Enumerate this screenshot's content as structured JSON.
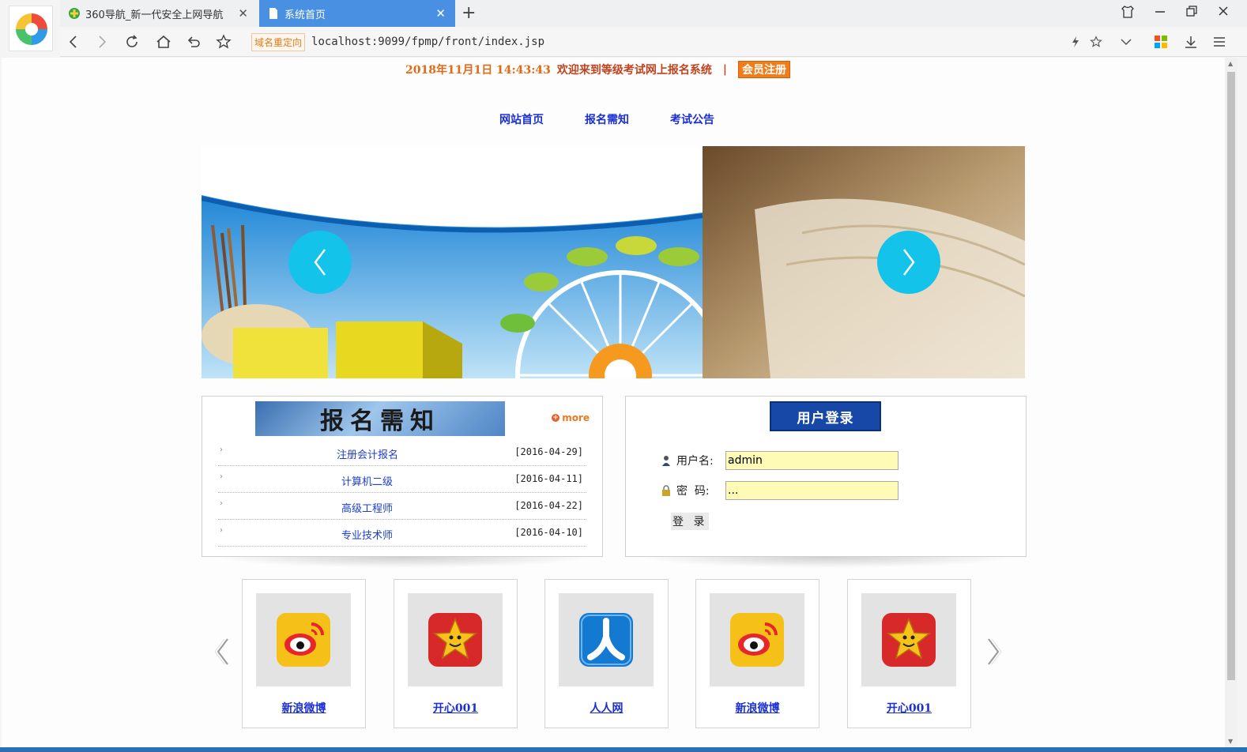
{
  "browser": {
    "tabs": [
      {
        "label": "360导航_新一代安全上网导航",
        "active": false
      },
      {
        "label": "系统首页",
        "active": true
      }
    ],
    "redirect_badge": "域名重定向",
    "url": "localhost:9099/fpmp/front/index.jsp",
    "accent": "#4a90e2"
  },
  "header": {
    "datetime": "2018年11月1日  14:43:43",
    "welcome": "欢迎来到等级考试网上报名系统",
    "separator": "|",
    "register": "会员注册"
  },
  "nav": {
    "items": [
      "网站首页",
      "报名需知",
      "考试公告"
    ]
  },
  "notice": {
    "title": "报名需知",
    "more": "more",
    "items": [
      {
        "title": "注册会计报名",
        "date": "[2016-04-29]"
      },
      {
        "title": "计算机二级",
        "date": "[2016-04-11]"
      },
      {
        "title": "高级工程师",
        "date": "[2016-04-22]"
      },
      {
        "title": "专业技术师",
        "date": "[2016-04-10]"
      }
    ]
  },
  "login": {
    "title": "用户登录",
    "username_label": "用户名:",
    "username_value": "admin",
    "password_label": "密  码:",
    "password_value": "...",
    "submit": "登 录"
  },
  "links": [
    {
      "name": "新浪微博",
      "icon": "weibo-icon"
    },
    {
      "name": "开心001",
      "icon": "kaixin-icon"
    },
    {
      "name": "人人网",
      "icon": "renren-icon"
    },
    {
      "name": "新浪微博",
      "icon": "weibo-icon"
    },
    {
      "name": "开心001",
      "icon": "kaixin-icon"
    }
  ],
  "colors": {
    "nav_link": "#1a2fd6",
    "banner_arrow": "#14c3ea",
    "login_title": "#1748a8",
    "input_bg": "#fdfbb6"
  }
}
